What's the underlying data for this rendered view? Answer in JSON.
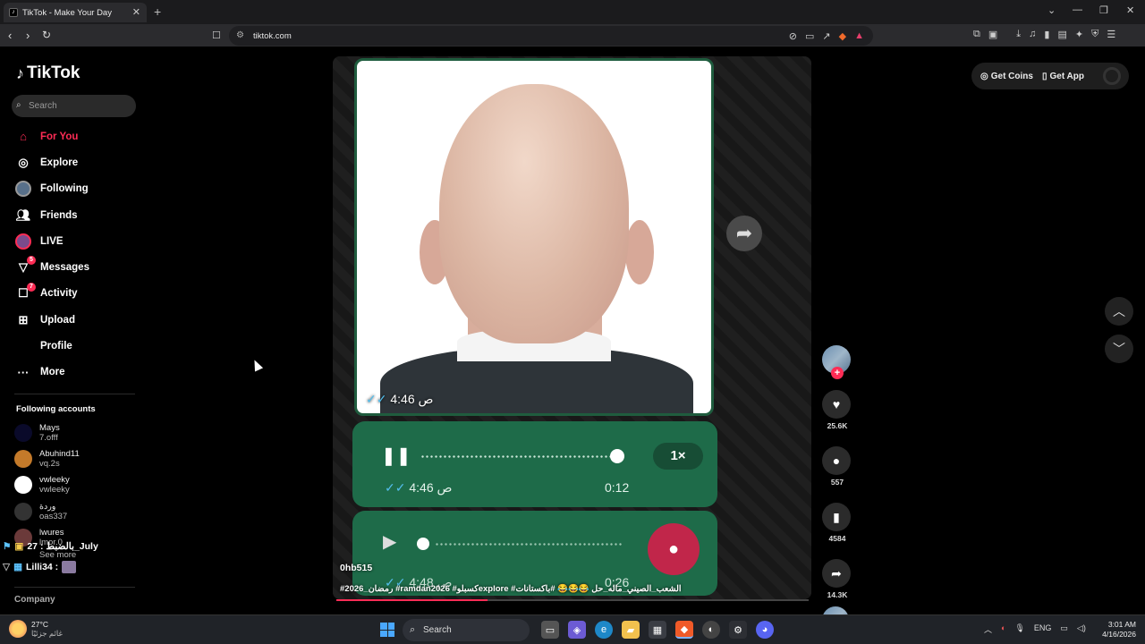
{
  "browser": {
    "tab_title": "TikTok - Make Your Day",
    "new_tab": "+",
    "url": "tiktok.com",
    "win_min": "—",
    "win_max": "❐",
    "win_close": "✕",
    "dropdown": "⌄"
  },
  "sidebar": {
    "logo": "TikTok",
    "search_placeholder": "Search",
    "menu": [
      {
        "label": "For You",
        "icon": "home-icon"
      },
      {
        "label": "Explore",
        "icon": "compass-icon"
      },
      {
        "label": "Following",
        "icon": "following-avatar-icon"
      },
      {
        "label": "Friends",
        "icon": "friends-icon"
      },
      {
        "label": "LIVE",
        "icon": "live-icon"
      },
      {
        "label": "Messages",
        "icon": "messages-icon",
        "badge": "5"
      },
      {
        "label": "Activity",
        "icon": "activity-icon",
        "badge": "7"
      },
      {
        "label": "Upload",
        "icon": "upload-icon"
      },
      {
        "label": "Profile",
        "icon": ""
      },
      {
        "label": "More",
        "icon": "more-icon"
      }
    ],
    "following_title": "Following accounts",
    "following": [
      {
        "name": "Mays",
        "user": "7.offf"
      },
      {
        "name": "Abuhind11",
        "user": "vq.2s"
      },
      {
        "name": "vwleeky",
        "user": "vwleeky"
      },
      {
        "name": "وردة",
        "user": "oas337"
      },
      {
        "name": "lwures",
        "user": "lmor.0"
      }
    ],
    "see_more": "See more",
    "company": "Company"
  },
  "overlay": {
    "line1": "بالضبط : 27_July",
    "line2": "Lilli34 :"
  },
  "video": {
    "time_1": "4:46 ص",
    "voice1_time": "4:46 ص",
    "voice1_duration": "0:12",
    "speed": "1×",
    "voice2_time": "4:48 ص",
    "voice2_duration": "0:26",
    "voice1_progress": 0.93,
    "author": "0hb515",
    "caption": "#2026_رمضان #ramdan2026 #كسبلوexplore #الشعب_الصيني_ماله_حل 😂😂😂 #باكستانات",
    "playback_progress": 0.32
  },
  "actions": {
    "likes": "25.6K",
    "comments": "557",
    "saves": "4584",
    "shares": "14.3K"
  },
  "topright": {
    "coins": "Get Coins",
    "app": "Get App"
  },
  "taskbar": {
    "temp": "27°C",
    "weather_sub": "غائم جزئيًا",
    "search": "Search",
    "lang": "ENG",
    "time": "3:01 AM",
    "date": "4/16/2026"
  },
  "colors": {
    "accent": "#fe2c55",
    "voice_bubble": "#1e6b49"
  }
}
